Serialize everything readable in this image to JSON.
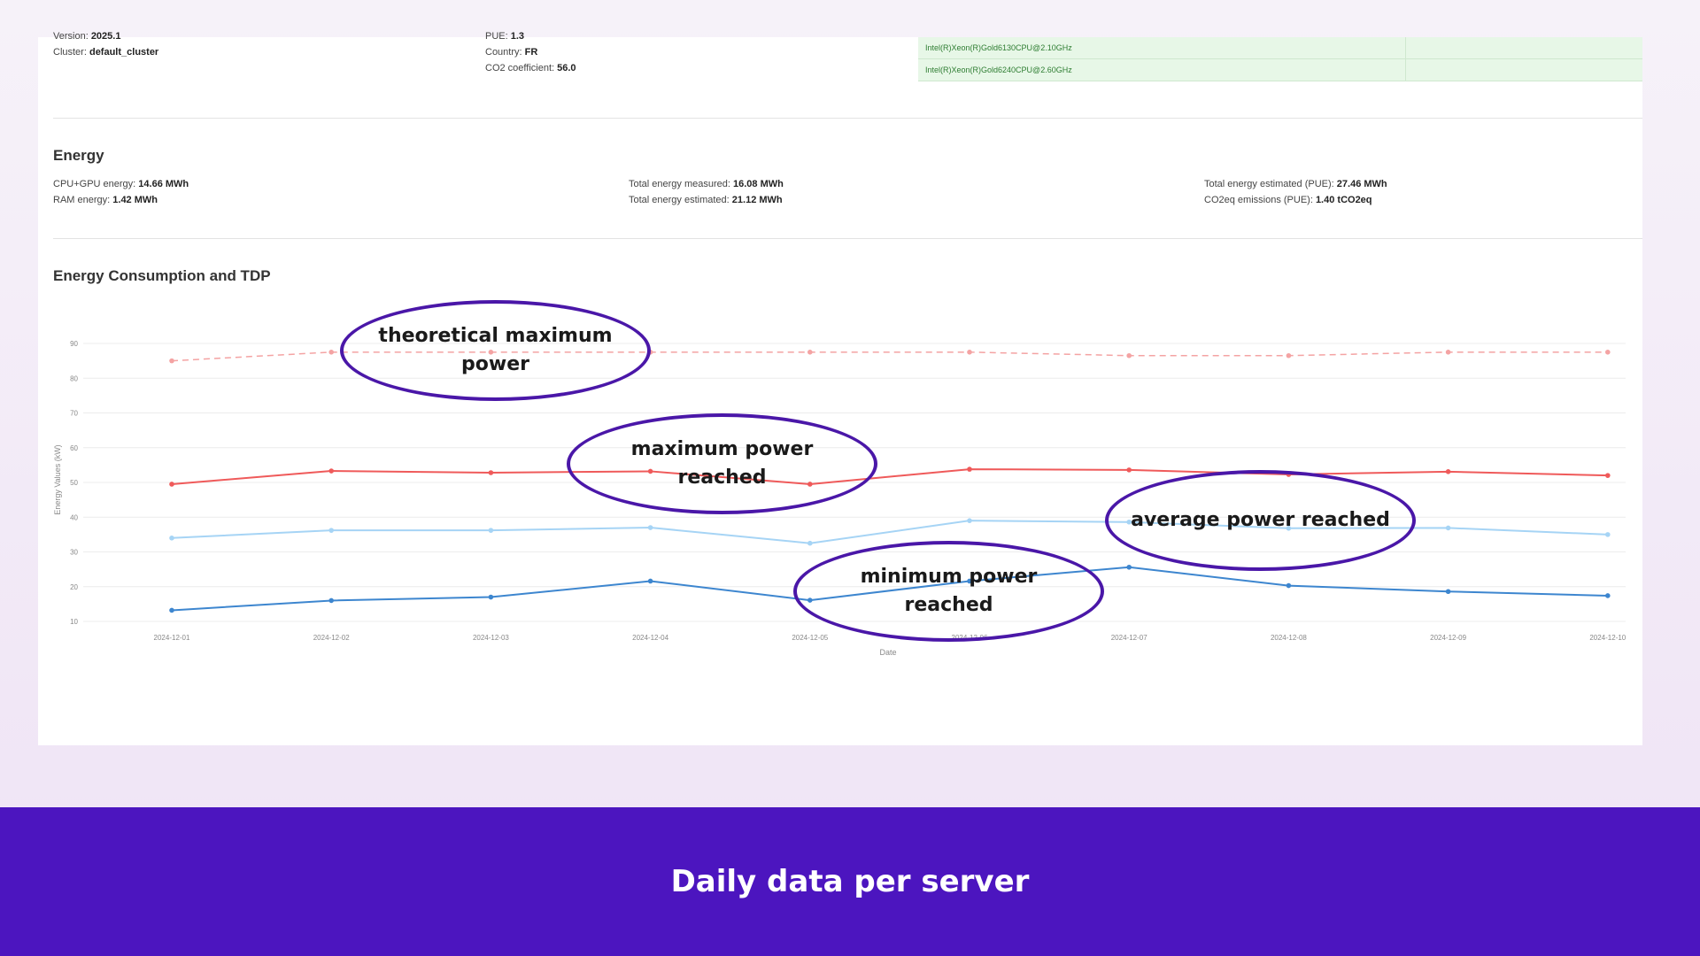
{
  "server_info": {
    "version_label": "Version:",
    "version_value": "2025.1",
    "cluster_label": "Cluster:",
    "cluster_value": "default_cluster",
    "pue_label": "PUE:",
    "pue_value": "1.3",
    "country_label": "Country:",
    "country_value": "FR",
    "co2_label": "CO2 coefficient:",
    "co2_value": "56.0",
    "cpus": [
      "Intel(R)Xeon(R)Gold6130CPU@2.10GHz",
      "Intel(R)Xeon(R)Gold6240CPU@2.60GHz"
    ]
  },
  "energy": {
    "title": "Energy",
    "cpu_gpu_label": "CPU+GPU energy:",
    "cpu_gpu_value": "14.66 MWh",
    "ram_label": "RAM energy:",
    "ram_value": "1.42 MWh",
    "total_measured_label": "Total energy measured:",
    "total_measured_value": "16.08 MWh",
    "total_estimated_label": "Total energy estimated:",
    "total_estimated_value": "21.12 MWh",
    "total_pue_label": "Total energy estimated (PUE):",
    "total_pue_value": "27.46 MWh",
    "co2_label": "CO2eq emissions (PUE):",
    "co2_value": "1.40 tCO2eq"
  },
  "chart_section": {
    "title": "Energy Consumption and TDP"
  },
  "annotations": {
    "theoretical": "theoretical maximum power",
    "max_reached": "maximum power reached",
    "avg_reached": "average power reached",
    "min_reached": "minimum power reached"
  },
  "footer": {
    "text": "Daily data per server"
  },
  "colors": {
    "tdp": "#f4a3a3",
    "max": "#ef5a5a",
    "avg": "#a6d4f5",
    "min": "#3d86cf",
    "bubble_border": "#4a17a8",
    "footer_bg": "#4c15bf"
  },
  "chart_data": {
    "type": "line",
    "xlabel": "Date",
    "ylabel": "Energy Values (kW)",
    "ylim": [
      10,
      90
    ],
    "yticks": [
      10,
      20,
      30,
      40,
      50,
      60,
      70,
      80,
      90
    ],
    "x": [
      "2024-12-01",
      "2024-12-02",
      "2024-12-03",
      "2024-12-04",
      "2024-12-05",
      "2024-12-06",
      "2024-12-07",
      "2024-12-08",
      "2024-12-09",
      "2024-12-10"
    ],
    "grid": true,
    "series": [
      {
        "key": "tdp",
        "dashed": true,
        "values": [
          85,
          87.5,
          87.5,
          87.5,
          87.5,
          87.5,
          86.5,
          86.5,
          87.5,
          87.5
        ]
      },
      {
        "key": "max",
        "dashed": false,
        "values": [
          49.5,
          53.3,
          52.8,
          53.2,
          49.5,
          53.8,
          53.6,
          52.3,
          53.1,
          52
        ]
      },
      {
        "key": "avg",
        "dashed": false,
        "values": [
          34,
          36.2,
          36.2,
          37,
          32.5,
          39,
          38.6,
          36.8,
          36.9,
          35
        ]
      },
      {
        "key": "min",
        "dashed": false,
        "values": [
          13.2,
          16,
          17,
          21.6,
          16.1,
          21.6,
          25.6,
          20.3,
          18.6,
          17.4
        ]
      }
    ]
  }
}
